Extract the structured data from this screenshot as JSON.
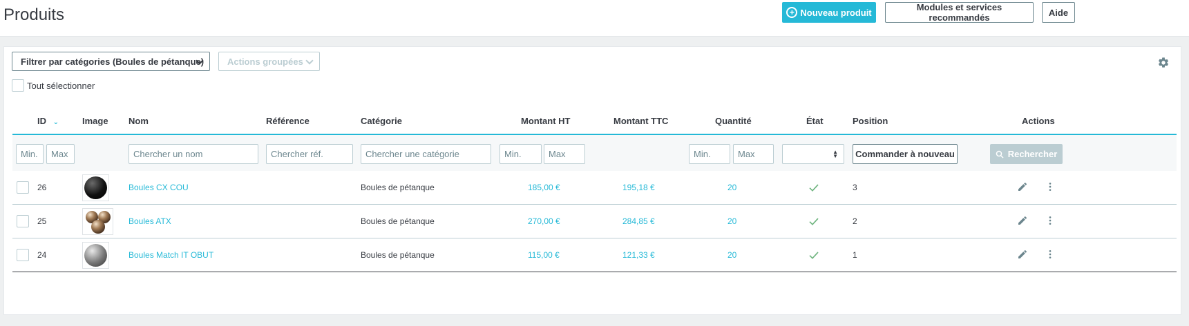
{
  "header": {
    "title": "Produits",
    "new_product": "Nouveau produit",
    "modules": "Modules et services recommandés",
    "help": "Aide"
  },
  "toolbar": {
    "category_filter": "Filtrer par catégories (Boules de pétanque)",
    "bulk_actions": "Actions groupées",
    "select_all": "Tout sélectionner"
  },
  "columns": {
    "id": "ID",
    "image": "Image",
    "name": "Nom",
    "reference": "Référence",
    "category": "Catégorie",
    "price_ht": "Montant HT",
    "price_ttc": "Montant TTC",
    "quantity": "Quantité",
    "state": "État",
    "position": "Position",
    "actions": "Actions"
  },
  "filters": {
    "id_min": "Min.",
    "id_max": "Max",
    "name": "Chercher un nom",
    "reference": "Chercher réf.",
    "category": "Chercher une catégorie",
    "price_min": "Min.",
    "price_max": "Max",
    "qty_min": "Min.",
    "qty_max": "Max",
    "reorder": "Commander à nouveau",
    "search": "Rechercher"
  },
  "rows": [
    {
      "id": "26",
      "name": "Boules CX COU",
      "category": "Boules de pétanque",
      "price_ht": "185,00 €",
      "price_ttc": "195,18 €",
      "quantity": "20",
      "position": "3",
      "image_icon": "black-ball-icon"
    },
    {
      "id": "25",
      "name": "Boules ATX",
      "category": "Boules de pétanque",
      "price_ht": "270,00 €",
      "price_ttc": "284,85 €",
      "quantity": "20",
      "position": "2",
      "image_icon": "three-balls-icon"
    },
    {
      "id": "24",
      "name": "Boules Match IT OBUT",
      "category": "Boules de pétanque",
      "price_ht": "115,00 €",
      "price_ttc": "121,33 €",
      "quantity": "20",
      "position": "1",
      "image_icon": "steel-ball-icon"
    }
  ],
  "colors": {
    "accent": "#25b9d7",
    "text": "#363a41",
    "success": "#70b580",
    "muted": "#bbcdd2"
  }
}
